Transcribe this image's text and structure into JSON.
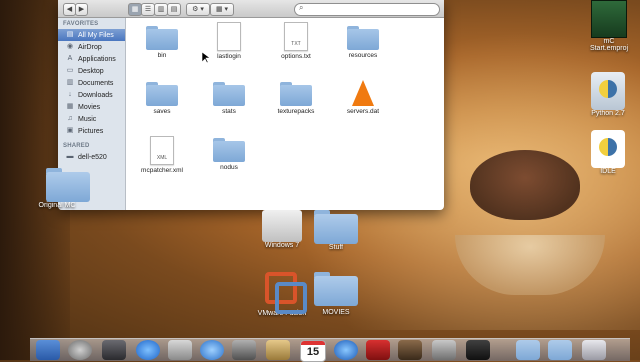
{
  "toolbar": {
    "back": "◀",
    "forward": "▶",
    "view_icons": [
      "▦",
      "☰",
      "▥",
      "▤"
    ],
    "action": "⚙ ▾",
    "arrange": "▦ ▾",
    "search_placeholder": "",
    "search_glyph": "⌕"
  },
  "sidebar": {
    "favorites_header": "FAVORITES",
    "favorites": [
      {
        "label": "All My Files",
        "icon": "▤",
        "selected": true
      },
      {
        "label": "AirDrop",
        "icon": "◉"
      },
      {
        "label": "Applications",
        "icon": "A"
      },
      {
        "label": "Desktop",
        "icon": "▭"
      },
      {
        "label": "Documents",
        "icon": "▥"
      },
      {
        "label": "Downloads",
        "icon": "↓"
      },
      {
        "label": "Movies",
        "icon": "▦"
      },
      {
        "label": "Music",
        "icon": "♫"
      },
      {
        "label": "Pictures",
        "icon": "▣"
      }
    ],
    "shared_header": "SHARED",
    "shared": [
      {
        "label": "dell-e520",
        "icon": "▬"
      }
    ]
  },
  "files": [
    {
      "name": "bin",
      "kind": "folder"
    },
    {
      "name": "lastlogin",
      "kind": "doc",
      "tag": ""
    },
    {
      "name": "options.txt",
      "kind": "doc",
      "tag": "TXT"
    },
    {
      "name": "resources",
      "kind": "folder"
    },
    {
      "name": "saves",
      "kind": "folder"
    },
    {
      "name": "stats",
      "kind": "folder"
    },
    {
      "name": "texturepacks",
      "kind": "folder"
    },
    {
      "name": "servers.dat",
      "kind": "vlc"
    },
    {
      "name": "mcpatcher.xml",
      "kind": "doc",
      "tag": "XML"
    },
    {
      "name": "nodus",
      "kind": "folder"
    }
  ],
  "desktop": {
    "mc": "mC Start.emproj",
    "python": "Python 2.7",
    "idle": "IDLE",
    "original": "Original MC",
    "windows": "Windows 7",
    "stuff": "Stuff",
    "vmware": "VMware Fusion",
    "movies": "MOVIES"
  },
  "dock": {
    "calendar_day": "15",
    "calendar_month": "JUL"
  }
}
